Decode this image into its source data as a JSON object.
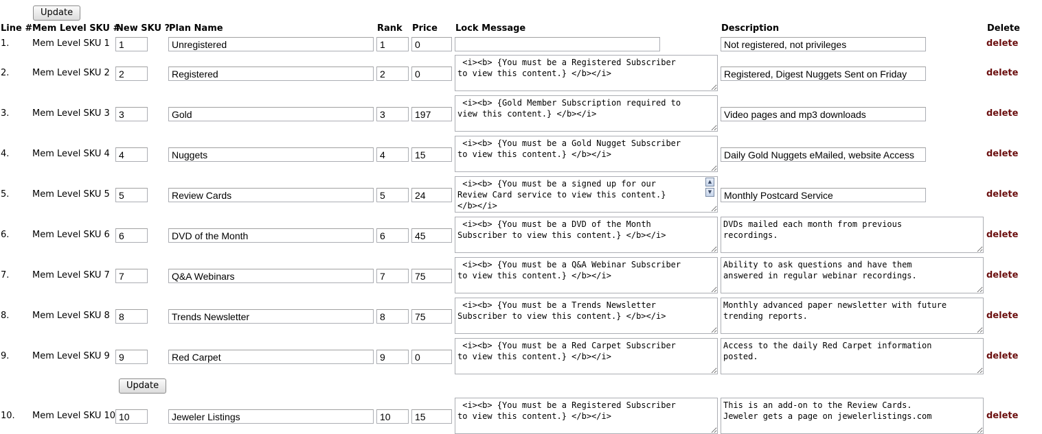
{
  "buttons": {
    "update_top": "Update",
    "update_mid": "Update"
  },
  "headers": {
    "line": "Line #",
    "mem_level_sku": "Mem Level SKU #",
    "new_sku": "New SKU ?",
    "plan_name": "Plan Name",
    "rank": "Rank",
    "price": "Price",
    "lock_message": "Lock Message",
    "description": "Description",
    "delete": "Delete"
  },
  "rows": [
    {
      "line": "1.",
      "sku": "Mem Level SKU 1",
      "new_sku": "1",
      "plan": "Unregistered",
      "rank": "1",
      "price": "0",
      "lock": "",
      "desc": "Not registered, not privileges",
      "delete": "delete"
    },
    {
      "line": "2.",
      "sku": "Mem Level SKU 2",
      "new_sku": "2",
      "plan": "Registered",
      "rank": "2",
      "price": "0",
      "lock": " <i><b> {You must be a Registered Subscriber\nto view this content.} </b></i>",
      "desc": "Registered, Digest Nuggets Sent on Friday",
      "delete": "delete"
    },
    {
      "line": "3.",
      "sku": "Mem Level SKU 3",
      "new_sku": "3",
      "plan": "Gold",
      "rank": "3",
      "price": "197",
      "lock": " <i><b> {Gold Member Subscription required to\nview this content.} </b></i>",
      "desc": "Video pages and mp3 downloads",
      "delete": "delete"
    },
    {
      "line": "4.",
      "sku": "Mem Level SKU 4",
      "new_sku": "4",
      "plan": "Nuggets",
      "rank": "4",
      "price": "15",
      "lock": " <i><b> {You must be a Gold Nugget Subscriber\nto view this content.} </b></i>",
      "desc": "Daily Gold Nuggets eMailed, website Access",
      "delete": "delete"
    },
    {
      "line": "5.",
      "sku": "Mem Level SKU 5",
      "new_sku": "5",
      "plan": "Review Cards",
      "rank": "5",
      "price": "24",
      "lock": " <i><b> {You must be a signed up for our\nReview Card service to view this content.}\n</b></i>",
      "desc": "Monthly Postcard Service",
      "delete": "delete"
    },
    {
      "line": "6.",
      "sku": "Mem Level SKU 6",
      "new_sku": "6",
      "plan": "DVD of the Month",
      "rank": "6",
      "price": "45",
      "lock": " <i><b> {You must be a DVD of the Month\nSubscriber to view this content.} </b></i>",
      "desc": "DVDs mailed each month from previous\nrecordings.",
      "delete": "delete"
    },
    {
      "line": "7.",
      "sku": "Mem Level SKU 7",
      "new_sku": "7",
      "plan": "Q&A Webinars",
      "rank": "7",
      "price": "75",
      "lock": " <i><b> {You must be a Q&A Webinar Subscriber\nto view this content.} </b></i>",
      "desc": "Ability to ask questions and have them\nanswered in regular webinar recordings.",
      "delete": "delete"
    },
    {
      "line": "8.",
      "sku": "Mem Level SKU 8",
      "new_sku": "8",
      "plan": "Trends Newsletter",
      "rank": "8",
      "price": "75",
      "lock": " <i><b> {You must be a Trends Newsletter\nSubscriber to view this content.} </b></i>",
      "desc": "Monthly advanced paper newsletter with future\ntrending reports.",
      "delete": "delete"
    },
    {
      "line": "9.",
      "sku": "Mem Level SKU 9",
      "new_sku": "9",
      "plan": "Red Carpet",
      "rank": "9",
      "price": "0",
      "lock": " <i><b> {You must be a Red Carpet Subscriber\nto view this content.} </b></i>",
      "desc": "Access to the daily Red Carpet information\nposted.",
      "delete": "delete"
    },
    {
      "line": "10.",
      "sku": "Mem Level SKU 10",
      "new_sku": "10",
      "plan": "Jeweler Listings",
      "rank": "10",
      "price": "15",
      "lock": " <i><b> {You must be a Registered Subscriber\nto view this content.} </b></i>",
      "desc": "This is an add-on to the Review Cards.\nJeweler gets a page on jewelerlistings.com",
      "delete": "delete"
    }
  ]
}
